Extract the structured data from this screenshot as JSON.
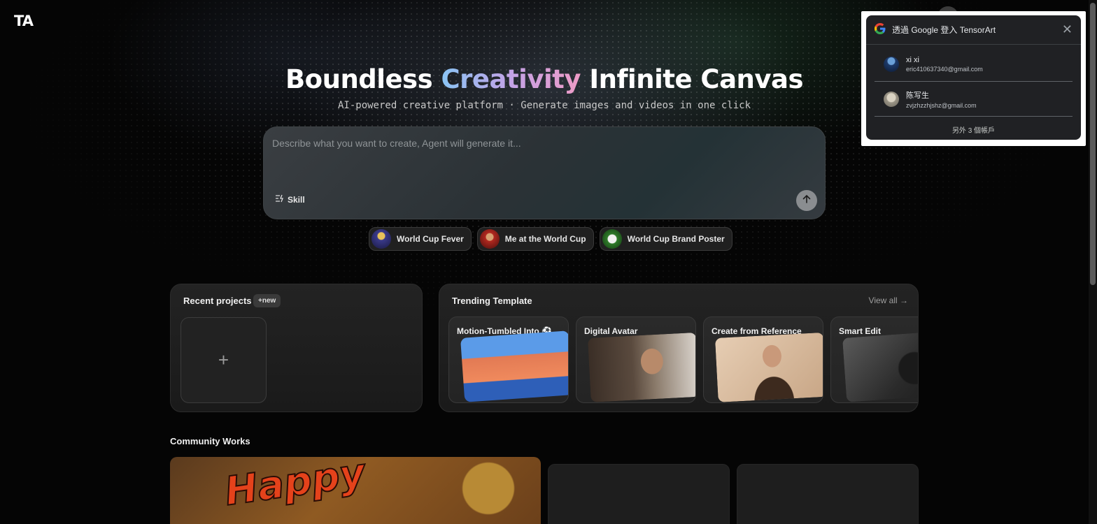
{
  "header": {
    "logo": "TA"
  },
  "hero": {
    "title_part1": "Boundless",
    "title_highlight": "Creativity",
    "title_part2": "Infinite Canvas",
    "subtitle": "AI-powered creative platform · Generate images and videos in one click"
  },
  "prompt": {
    "placeholder": "Describe what you want to create, Agent will generate it...",
    "skill_label": "Skill"
  },
  "chips": [
    {
      "label": "World Cup Fever"
    },
    {
      "label": "Me at the World Cup"
    },
    {
      "label": "World Cup Brand Poster"
    }
  ],
  "recent": {
    "title": "Recent projects",
    "new_badge": "+new",
    "add_symbol": "+"
  },
  "trending": {
    "title": "Trending Template",
    "view_all": "View all →",
    "templates": [
      {
        "label": "Motion-Tumbled Into ⚽"
      },
      {
        "label": "Digital Avatar"
      },
      {
        "label": "Create from Reference"
      },
      {
        "label": "Smart Edit"
      }
    ]
  },
  "community": {
    "title": "Community Works",
    "featured_text": "Happy"
  },
  "google_signin": {
    "title": "透過 Google 登入 TensorArt",
    "accounts": [
      {
        "name": "xi xi",
        "email": "eric410637340@gmail.com"
      },
      {
        "name": "陈写生",
        "email": "zvjzhzzhjshz@gmail.com"
      }
    ],
    "more_accounts": "另外 3 個帳戶"
  },
  "colors": {
    "background": "#050505",
    "title_gradient": [
      "#8ac4f4",
      "#c3a2e6",
      "#ef9cc7"
    ],
    "google_panel": "#202124"
  }
}
